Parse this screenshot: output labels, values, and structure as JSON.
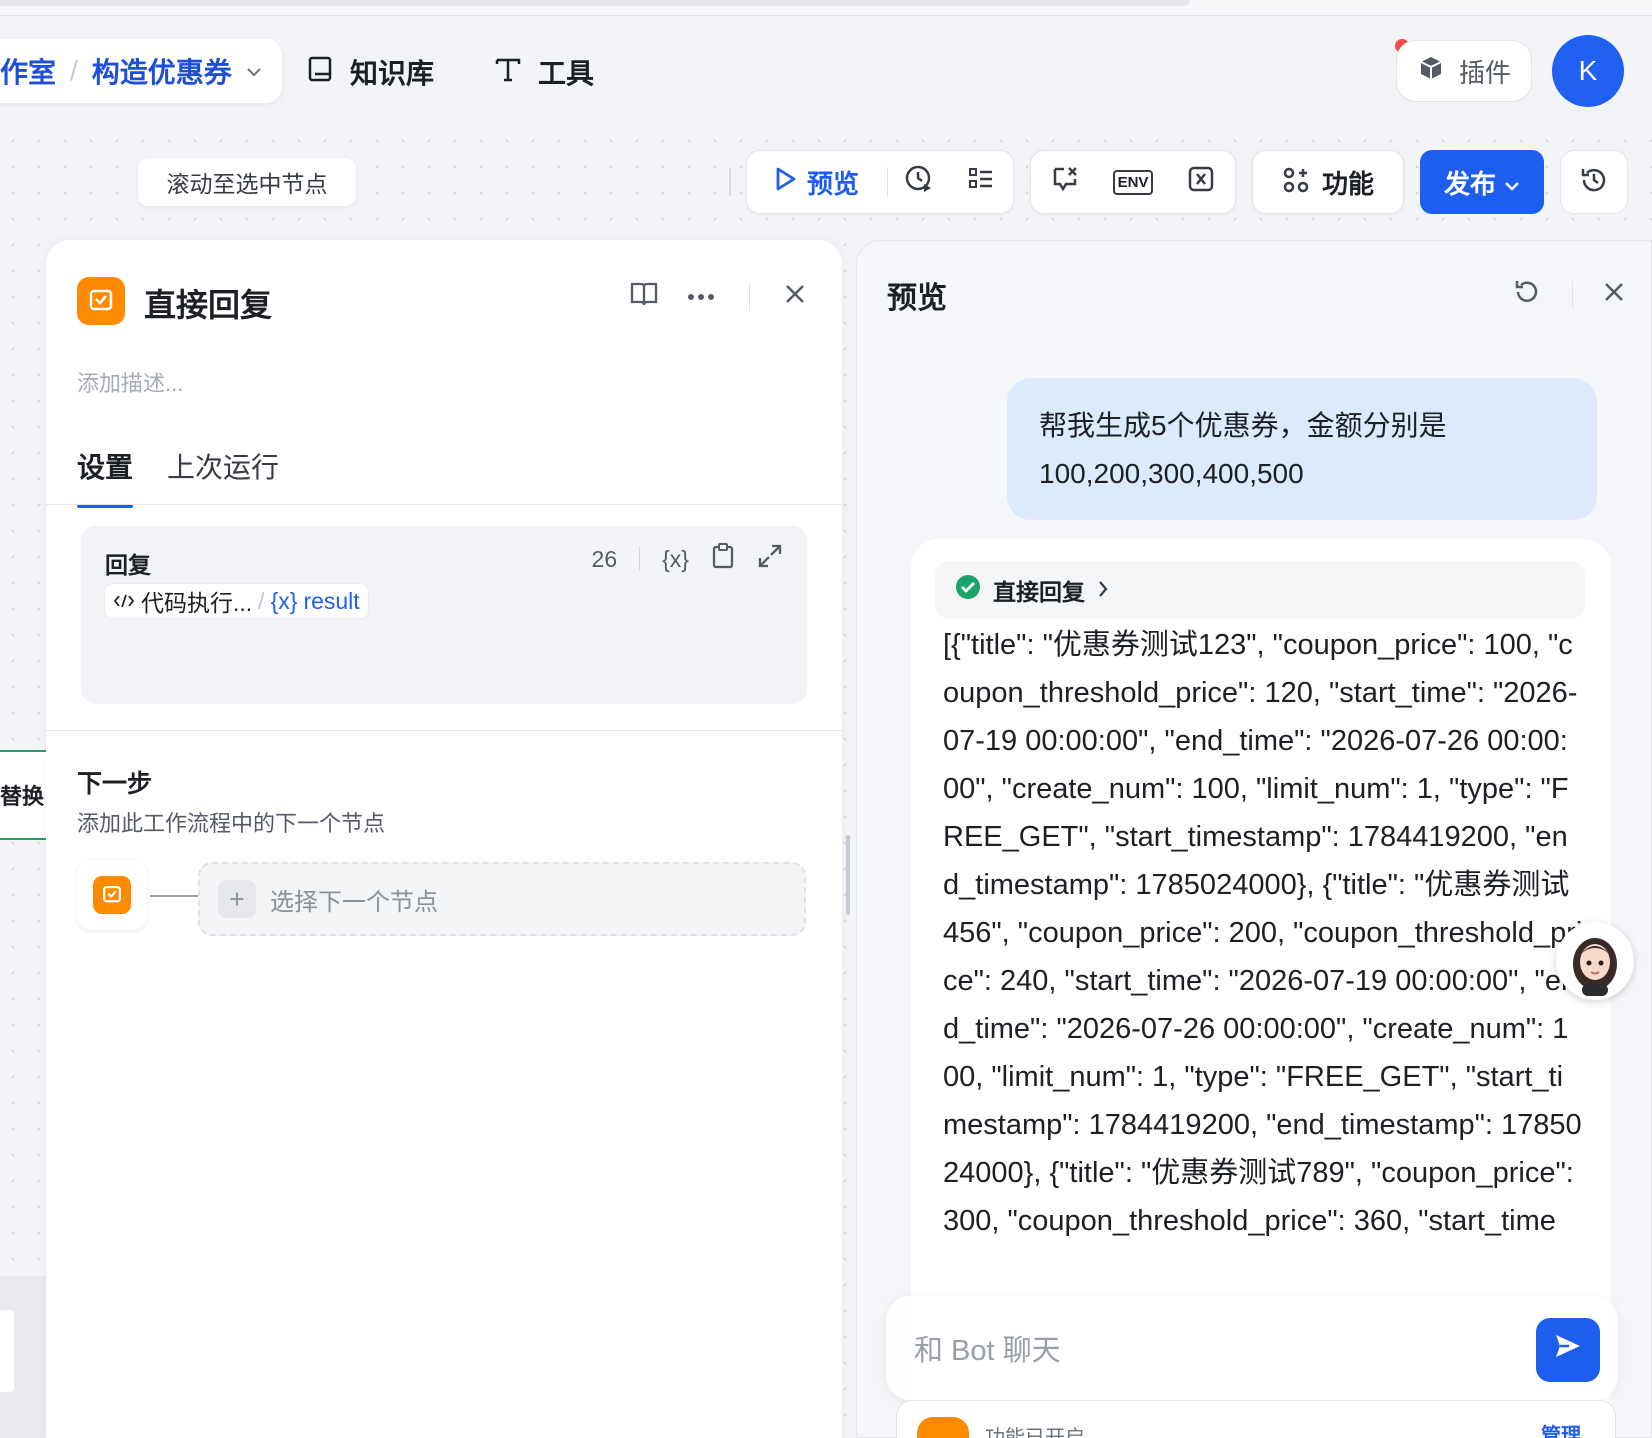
{
  "header": {
    "breadcrumb_parent": "作室",
    "breadcrumb_separator": "/",
    "breadcrumb_current": "构造优惠券",
    "nav": {
      "knowledge": "知识库",
      "tools": "工具"
    },
    "plugin_label": "插件",
    "avatar_letter": "K"
  },
  "toolbar": {
    "scroll_to_node": "滚动至选中节点",
    "preview": "预览",
    "env_label": "ENV",
    "features": "功能",
    "publish": "发布"
  },
  "node_panel": {
    "title": "直接回复",
    "description_placeholder": "添加描述...",
    "tabs": [
      "设置",
      "上次运行"
    ],
    "reply": {
      "label": "回复",
      "count": "26",
      "var_token": "{x}",
      "chip_source": "代码执行...",
      "chip_sep": "/",
      "chip_var": "result"
    },
    "next": {
      "title": "下一步",
      "subtitle": "添加此工作流程中的下一个节点",
      "select_placeholder": "选择下一个节点"
    },
    "left_edge_node_label": "替换"
  },
  "preview_panel": {
    "title": "预览",
    "user_message": "帮我生成5个优惠券，金额分别是100,200,300,400,500",
    "bot_status": "直接回复",
    "bot_reply": "[{\"title\": \"优惠券测试123\", \"coupon_price\": 100, \"coupon_threshold_price\": 120, \"start_time\": \"2026-07-19 00:00:00\", \"end_time\": \"2026-07-26 00:00:00\", \"create_num\": 100, \"limit_num\": 1, \"type\": \"FREE_GET\", \"start_timestamp\": 1784419200, \"end_timestamp\": 1785024000}, {\"title\": \"优惠券测试456\", \"coupon_price\": 200, \"coupon_threshold_price\": 240, \"start_time\": \"2026-07-19 00:00:00\", \"end_time\": \"2026-07-26 00:00:00\", \"create_num\": 100, \"limit_num\": 1, \"type\": \"FREE_GET\", \"start_timestamp\": 1784419200, \"end_timestamp\": 1785024000}, {\"title\": \"优惠券测试789\", \"coupon_price\": 300, \"coupon_threshold_price\": 360, \"start_time",
    "chat_placeholder": "和 Bot 聊天",
    "footer_text": "功能已开启",
    "footer_manage": "管理"
  },
  "colors": {
    "primary": "#1e5eef",
    "node_orange": "#ff8a00",
    "success_green": "#1aa36a"
  }
}
